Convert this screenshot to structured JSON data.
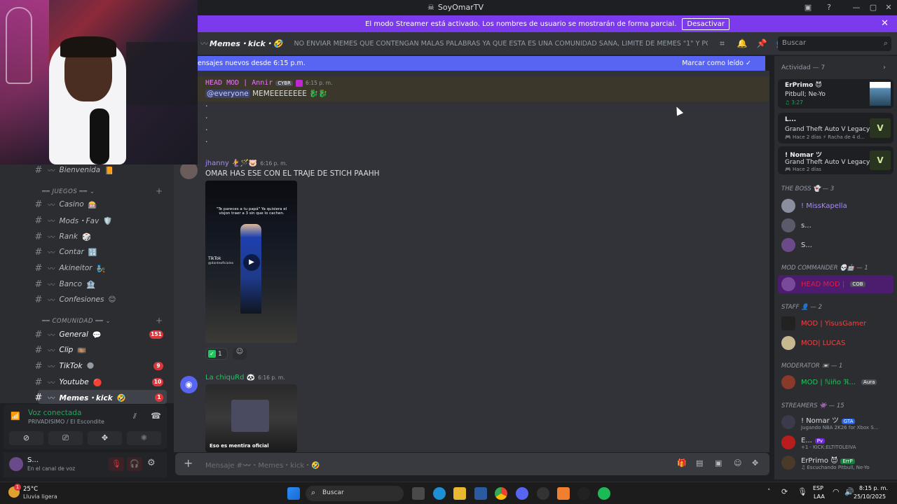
{
  "titlebar": {
    "title": "SoyOmarTV"
  },
  "streamer_banner": {
    "text": "El modo Streamer está activado. Los nombres de usuario se mostrarán de forma parcial.",
    "button": "Desactivar"
  },
  "header": {
    "channel": "Memes・kick・🤣",
    "topic": "NO ENVIAR MEMES QUE CONTENGAN MALAS PALABRAS YA QUE ESTA ES UNA COMUNIDAD SANA, LIMITE DE MEMES \"1\" Y POR ULTIMO EL ...",
    "search_placeholder": "Buscar"
  },
  "newbar": {
    "text": "ensajes nuevos desde 6:15 p.m.",
    "mark": "Marcar como leído"
  },
  "messages": [
    {
      "author": "HEAD MOD | Annir",
      "tag": "CYBR",
      "time": "6:15 p. m.",
      "mention": "@everyone",
      "text": "MEMEEEEEEEE 🐉🐉",
      "dots": [
        ".",
        ".",
        ".",
        "."
      ]
    },
    {
      "author": "jhanny 🧜‍♀️🪄🐷",
      "time": "6:16 p. m.",
      "text": "OMAR HAS ESE CON EL TRAJE DE STICH PAAHH",
      "video_caption": "\"Te pareces a tu papá\" Ya quisiera el visjon traer a 3 sin que lo cachen.",
      "video_brand": "TikTok",
      "video_handle": "@danteoficialex",
      "reaction_count": "1"
    },
    {
      "author": "La chiquRd 🐼",
      "time": "6:16 p. m.",
      "video_caption": "Eso es mentira oficial"
    }
  ],
  "composer": {
    "placeholder": "Mensaje #〰️・Memes・kick・🤣"
  },
  "channels": [
    {
      "name": "Bienvenida",
      "emoji": "📙"
    },
    {
      "category": "JUEGOS"
    },
    {
      "name": "Casino",
      "emoji": "🎰"
    },
    {
      "name": "Mods・Fav",
      "emoji": "🛡️"
    },
    {
      "name": "Rank",
      "emoji": "🎲"
    },
    {
      "name": "Contar",
      "emoji": "🔢"
    },
    {
      "name": "Akineitor",
      "emoji": "🧞"
    },
    {
      "name": "Banco",
      "emoji": "🏦"
    },
    {
      "name": "Confesiones",
      "emoji": "😊"
    },
    {
      "category": "COMUNIDAD"
    },
    {
      "name": "General",
      "emoji": "💬",
      "badge": "151"
    },
    {
      "name": "Clip",
      "emoji": "🎞️"
    },
    {
      "name": "TikTok",
      "emoji": "🌑",
      "badge": "9"
    },
    {
      "name": "Youtube",
      "emoji": "🔴",
      "badge": "10"
    },
    {
      "name": "Memes・kick",
      "emoji": "🤣",
      "badge": "1",
      "active": true
    }
  ],
  "voice": {
    "status": "Voz conectada",
    "channel": "PRIVADISIMO / El Escondite"
  },
  "user": {
    "name": "S...",
    "status": "En el canal de voz"
  },
  "members": {
    "activity_title": "Actividad — 7",
    "activities": [
      {
        "name": "ErPrimo 😈",
        "game": "Pitbull; Ne-Yo",
        "sub": "♫ 3:27"
      },
      {
        "name": "L...",
        "game": "Grand Theft Auto V Legacy",
        "sub": "🎮 Hace 2 días ⚡ Racha de 4 d..."
      },
      {
        "name": "! Nomar ツ",
        "game": "Grand Theft Auto V Legacy",
        "sub": "🎮 Hace 2 días"
      }
    ],
    "sections": [
      {
        "title": "THE BOSS 👻 — 3",
        "items": [
          {
            "name": "! MissKapella",
            "color": "#a78bfa"
          },
          {
            "name": "s...",
            "color": "#dbdee1"
          },
          {
            "name": "S...",
            "color": "#dbdee1"
          }
        ]
      },
      {
        "title": "MOD COMMANDER 💀🤖 — 1",
        "items": [
          {
            "name": "HEAD MOD |",
            "color": "#e11d48",
            "tag": "COB"
          }
        ]
      },
      {
        "title": "STAFF 👤 — 2",
        "items": [
          {
            "name": "MOD | YisusGamer",
            "color": "#ef4444"
          },
          {
            "name": "MOD| LUCAS",
            "color": "#ef4444"
          }
        ]
      },
      {
        "title": "MODERATOR 📼 — 1",
        "items": [
          {
            "name": "MOD | ℕiño ℜ...",
            "color": "#22c55e",
            "tag": "Aura"
          }
        ]
      },
      {
        "title": "STREAMERS 👾 — 15",
        "items": [
          {
            "name": "! Nomar ツ",
            "color": "#dbdee1",
            "tag": "GTA",
            "sub": "Jugando NBA 2K26 for Xbox S..."
          },
          {
            "name": "E...",
            "color": "#dbdee1",
            "tag": "Pv",
            "sub": "+1 · KICK:ELTITOLEIVA"
          },
          {
            "name": "ErPrimo 😈",
            "color": "#dbdee1",
            "tag": "ErrP",
            "sub": "♫ Escuchando Pitbull, Ne-Yo"
          }
        ]
      }
    ]
  },
  "taskbar": {
    "weather_temp": "25°C",
    "weather_desc": "Lluvia ligera",
    "search": "Buscar",
    "lang": "ESP",
    "lang2": "LAA",
    "time": "8:15 p. m.",
    "date": "25/10/2025"
  }
}
